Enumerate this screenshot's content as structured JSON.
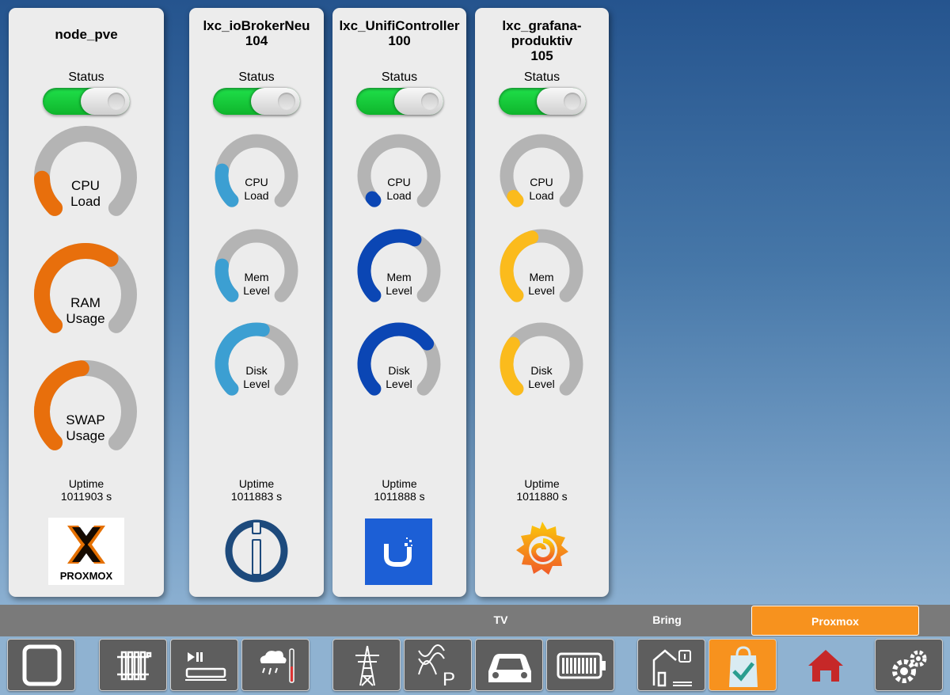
{
  "colors": {
    "track": "#b4b4b4",
    "node_accent": "#e86f0c",
    "iobroker_accent": "#3c9fd2",
    "unifi_accent": "#0b46b4",
    "grafana_accent": "#fbbb1c",
    "tab_active": "#f7921e"
  },
  "cards": [
    {
      "title_lines": [
        "node_pve"
      ],
      "status_label": "Status",
      "status_on": true,
      "gauges": [
        {
          "label1": "CPU",
          "label2": "Load",
          "value": 0.16
        },
        {
          "label1": "RAM",
          "label2": "Usage",
          "value": 0.63
        },
        {
          "label1": "SWAP",
          "label2": "Usage",
          "value": 0.48
        }
      ],
      "uptime_label": "Uptime",
      "uptime_value": "1011903 s",
      "logo": "proxmox-logo",
      "logo_text": "PROXMOX"
    },
    {
      "title_lines": [
        "lxc_ioBrokerNeu",
        "104"
      ],
      "status_label": "Status",
      "status_on": true,
      "gauges": [
        {
          "label1": "CPU",
          "label2": "Load",
          "value": 0.2
        },
        {
          "label1": "Mem",
          "label2": "Level",
          "value": 0.2
        },
        {
          "label1": "Disk",
          "label2": "Level",
          "value": 0.54
        }
      ],
      "uptime_label": "Uptime",
      "uptime_value": "1011883 s",
      "logo": "iobroker-logo"
    },
    {
      "title_lines": [
        "lxc_UnifiController",
        "100"
      ],
      "status_label": "Status",
      "status_on": true,
      "gauges": [
        {
          "label1": "CPU",
          "label2": "Load",
          "value": 0.02
        },
        {
          "label1": "Mem",
          "label2": "Level",
          "value": 0.6
        },
        {
          "label1": "Disk",
          "label2": "Level",
          "value": 0.7
        }
      ],
      "uptime_label": "Uptime",
      "uptime_value": "1011888 s",
      "logo": "unifi-logo"
    },
    {
      "title_lines": [
        "lxc_grafana-",
        "produktiv",
        "105"
      ],
      "status_label": "Status",
      "status_on": true,
      "gauges": [
        {
          "label1": "CPU",
          "label2": "Load",
          "value": 0.03
        },
        {
          "label1": "Mem",
          "label2": "Level",
          "value": 0.44
        },
        {
          "label1": "Disk",
          "label2": "Level",
          "value": 0.3
        }
      ],
      "uptime_label": "Uptime",
      "uptime_value": "1011880 s",
      "logo": "grafana-logo"
    }
  ],
  "tabs": [
    {
      "label": "TV",
      "active": false
    },
    {
      "label": "Bring",
      "active": false
    },
    {
      "label": "Proxmox",
      "active": true
    }
  ],
  "dock": [
    {
      "icon": "square-frame-icon"
    },
    {
      "icon": "radiator-icon"
    },
    {
      "icon": "media-player-icon"
    },
    {
      "icon": "weather-icon"
    },
    {
      "icon": "power-pylon-icon"
    },
    {
      "icon": "solar-panel-icon"
    },
    {
      "icon": "car-icon"
    },
    {
      "icon": "battery-icon"
    },
    {
      "icon": "house-info-icon"
    },
    {
      "icon": "shopping-bag-check-icon",
      "active": true
    },
    {
      "icon": "home-icon"
    },
    {
      "icon": "gears-icon"
    }
  ]
}
